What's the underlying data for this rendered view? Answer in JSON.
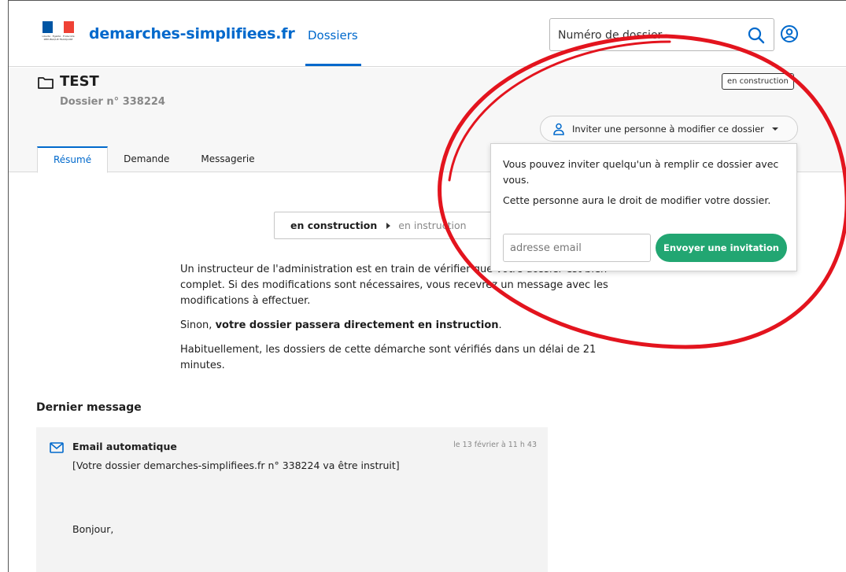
{
  "header": {
    "brand": "demarches-simplifiees.fr",
    "logo_small_text": "Liberté · Égalité · Fraternité RÉPUBLIQUE FRANÇAISE",
    "nav_dossiers": "Dossiers",
    "search_placeholder": "Numéro de dossier",
    "icons": {
      "search": "search-icon",
      "user": "user-icon"
    },
    "colors": {
      "brand": "#0069cc",
      "flag_blue": "#0055a4",
      "flag_red": "#ef4135"
    }
  },
  "dossier": {
    "title": "TEST",
    "number": "Dossier n° 338224",
    "status_badge": "en construction",
    "invite_button": "Inviter une personne à modifier ce dossier"
  },
  "tabs": [
    {
      "label": "Résumé",
      "active": true
    },
    {
      "label": "Demande",
      "active": false
    },
    {
      "label": "Messagerie",
      "active": false
    }
  ],
  "invite_dropdown": {
    "text1": "Vous pouvez inviter quelqu'un à remplir ce dossier avec vous.",
    "text2": "Cette personne aura le droit de modifier votre dossier.",
    "email_placeholder": "adresse email",
    "send_button": "Envoyer une invitation",
    "send_color": "#22a672"
  },
  "stepper": {
    "current": "en construction",
    "next": "en instruction"
  },
  "summary": {
    "para1": "Un instructeur de l'administration est en train de vérifier que votre dossier est bien complet. Si des modifications sont nécessaires, vous recevrez un message avec les modifications à effectuer.",
    "para2_prefix": "Sinon, ",
    "para2_bold": "votre dossier passera directement en instruction",
    "para2_suffix": ".",
    "para3": "Habituellement, les dossiers de cette démarche sont vérifiés dans un délai de 21 minutes."
  },
  "last_message": {
    "heading": "Dernier message",
    "from": "Email automatique",
    "date": "le 13 février à 11 h 43",
    "subject": "[Votre dossier demarches-simplifiees.fr n° 338224 va être instruit]",
    "greeting": "Bonjour,"
  },
  "annotation_color": "#e3141e"
}
